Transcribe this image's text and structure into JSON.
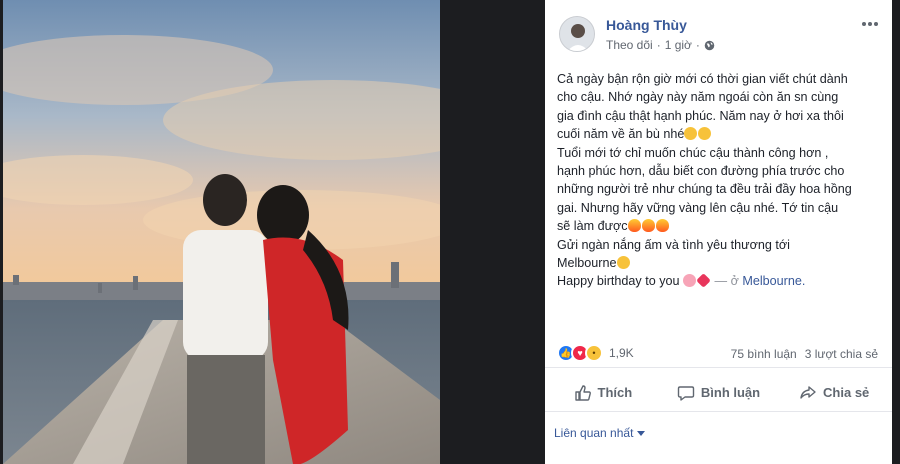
{
  "post": {
    "author": "Hoàng Thùy",
    "follow_label": "Theo dõi",
    "separator": "·",
    "time": "1 giờ",
    "body_lines": [
      "Cả ngày bận rộn giờ mới có thời gian viết chút dành",
      "cho cậu. Nhớ ngày này năm ngoái còn ăn sn cùng",
      "gia đình cậu thật hạnh phúc. Năm nay ở hơi xa thôi",
      "cuối năm về ăn bù nhé",
      "Tuổi mới tớ chỉ muốn chúc cậu thành công hơn ,",
      "hạnh phúc hơn, dẫu biết con đường phía trước cho",
      "những người trẻ như chúng ta đều trải đầy hoa hồng",
      "gai. Nhưng hãy vững vàng lên cậu nhé. Tớ tin cậu",
      "sẽ làm được",
      "Gửi ngàn nắng ấm và tình yêu thương tới",
      "Melbourne",
      "Happy birthday to you"
    ],
    "location_prefix": "— ở",
    "location": "Melbourne."
  },
  "stats": {
    "reaction_count": "1,9K",
    "comments": "75 bình luận",
    "shares": "3 lượt chia sẻ"
  },
  "actions": {
    "like": "Thích",
    "comment": "Bình luận",
    "share": "Chia sẻ"
  },
  "related_label": "Liên quan nhất",
  "icons": {
    "more": "more-dots-icon",
    "globe": "globe-icon",
    "like": "thumbs-up-icon",
    "comment": "comment-icon",
    "share": "share-icon"
  },
  "colors": {
    "link": "#385898",
    "like_blue": "#2078f4",
    "love_red": "#f0284a",
    "wow_yellow": "#f7c23a"
  }
}
